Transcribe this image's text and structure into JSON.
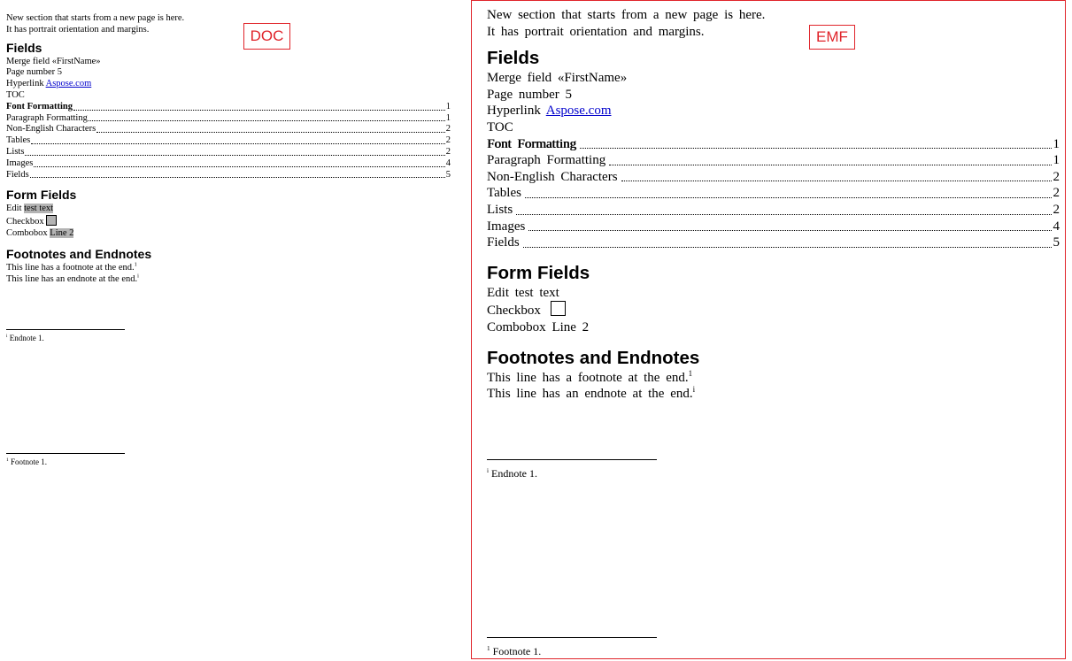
{
  "labels": {
    "doc": "DOC",
    "emf": "EMF"
  },
  "colors": {
    "frame": "#e0242a",
    "link": "#0000cc",
    "field_shading": "#b3b3b3"
  },
  "intro": {
    "line1": "New section that starts from a new page is here.",
    "line2": "It has portrait orientation and margins.",
    "line2_emf": "It has portrait orientation  and margins."
  },
  "fields": {
    "heading": "Fields",
    "merge_label": "Merge field ",
    "merge_value": "«FirstName»",
    "page_label": "Page number ",
    "page_value": "5",
    "hyperlink_label": "Hyperlink ",
    "hyperlink_text": "Aspose.com",
    "toc_label": "TOC",
    "toc": [
      {
        "title": "Font Formatting",
        "page": "1"
      },
      {
        "title": "Paragraph Formatting",
        "page": "1"
      },
      {
        "title": "Non-English Characters",
        "page": "2"
      },
      {
        "title": "Tables",
        "page": "2"
      },
      {
        "title": "Lists",
        "page": "2"
      },
      {
        "title": "Images",
        "page": "4"
      },
      {
        "title": "Fields",
        "page": "5"
      }
    ]
  },
  "form_fields": {
    "heading": "Form Fields",
    "edit_label": "Edit ",
    "edit_value": "test text",
    "checkbox_label": "Checkbox ",
    "combobox_label": "Combobox ",
    "combobox_value": "Line 2"
  },
  "notes": {
    "heading": "Footnotes and Endnotes",
    "footnote_line": "This line has a footnote at the end.",
    "footnote_mark": "1",
    "endnote_line": "This line has an endnote at the end.",
    "endnote_mark": "i",
    "endnote_text": "Endnote 1.",
    "footnote_text": "Footnote 1."
  }
}
